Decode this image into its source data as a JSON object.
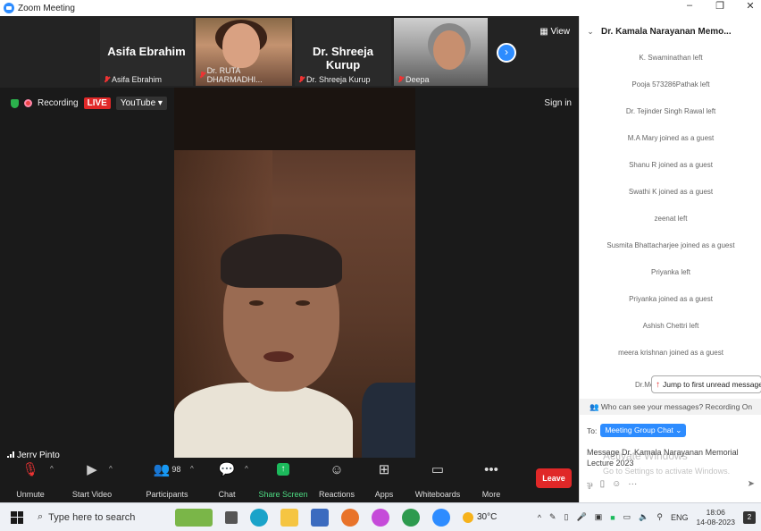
{
  "window": {
    "title": "Zoom Meeting"
  },
  "thumbnails": [
    {
      "display_name": "Asifa Ebrahim",
      "tag_name": "Asifa Ebrahim",
      "muted": true
    },
    {
      "display_name": "",
      "tag_name": "Dr. RUTA DHARMADHI...",
      "muted": true
    },
    {
      "display_name": "Dr. Shreeja Kurup",
      "tag_name": "Dr. Shreeja Kurup",
      "muted": true
    },
    {
      "display_name": "",
      "tag_name": "Deepa",
      "muted": true
    }
  ],
  "top_controls": {
    "view_label": "View",
    "sign_in_label": "Sign in"
  },
  "recording": {
    "label": "Recording",
    "live_badge": "LIVE",
    "stream_target": "YouTube"
  },
  "active_speaker": {
    "name": "Jerry Pinto"
  },
  "toolbar": {
    "unmute": "Unmute",
    "start_video": "Start Video",
    "participants": "Participants",
    "participants_count": "98",
    "chat": "Chat",
    "share_screen": "Share Screen",
    "reactions": "Reactions",
    "apps": "Apps",
    "whiteboards": "Whiteboards",
    "more": "More",
    "leave": "Leave"
  },
  "chat": {
    "title": "Dr. Kamala Narayanan Memo...",
    "messages": [
      "K. Swaminathan left",
      "Pooja 573286Pathak left",
      "Dr. Tejinder Singh Rawal left",
      "M.A Mary joined as a guest",
      "Shanu R joined as a guest",
      "Swathi K joined as a guest",
      "zeenat left",
      "Susmita Bhattacharjee joined as a guest",
      "Priyanka left",
      "Priyanka joined as a guest",
      "Ashish Chettri left",
      "meera krishnan joined as a guest"
    ],
    "partial_message": "Dr.Me",
    "jump_label": "Jump to first unread message",
    "visibility_note": "Who can see your messages? Recording On",
    "to_label": "To:",
    "to_recipient": "Meeting Group Chat",
    "compose_text": "Message Dr. Kamala Narayanan Memorial Lecture 2023",
    "watermark_line1": "Activate Windows",
    "watermark_line2": "Go to Settings to activate Windows."
  },
  "taskbar": {
    "search_placeholder": "Type here to search",
    "temperature": "30°C",
    "language": "ENG",
    "time": "18:06",
    "date": "14-08-2023",
    "notification_count": "2"
  },
  "colors": {
    "zoom_blue": "#2d8cff",
    "live_red": "#e02828",
    "share_green": "#1cba5c"
  }
}
